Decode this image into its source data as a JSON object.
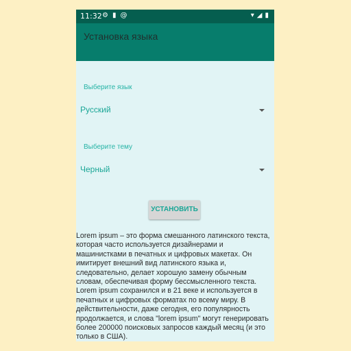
{
  "status_bar": {
    "time": "11:32",
    "left_icons": [
      "gear-icon",
      "sd-card-icon",
      "at-sign-icon"
    ],
    "right_icons": [
      "wifi-icon",
      "signal-icon",
      "battery-icon"
    ]
  },
  "app_bar": {
    "title": "Установка языка"
  },
  "language": {
    "label": "Выберите язык",
    "selected": "Русский"
  },
  "theme": {
    "label": "Выберите тему",
    "selected": "Черный"
  },
  "install_button": {
    "label": "УСТАНОВИТЬ"
  },
  "body_text": "Lorem ipsum – это форма смешанного латинского текста, которая часто используется дизайнерами и машинистками в печатных и цифровых макетах. Он имитирует внешний вид латинского языка и, следовательно, делает хорошую замену обычным словам, обеспечивая форму бессмысленного текста. Lorem ipsum сохранился и в 21 веке и используется в печатных и цифровых форматах по всему миру. В действительности, даже сегодня, его популярность продолжается, и слова \"lorem ipsum\" могут генерировать более 200000 поисковых запросов каждый месяц (и это только в США).",
  "colors": {
    "background": "#fdf0c4",
    "screen": "#e1f4f5",
    "status_bar": "#055e4f",
    "app_bar": "#077d6c",
    "accent": "#1aa696"
  }
}
